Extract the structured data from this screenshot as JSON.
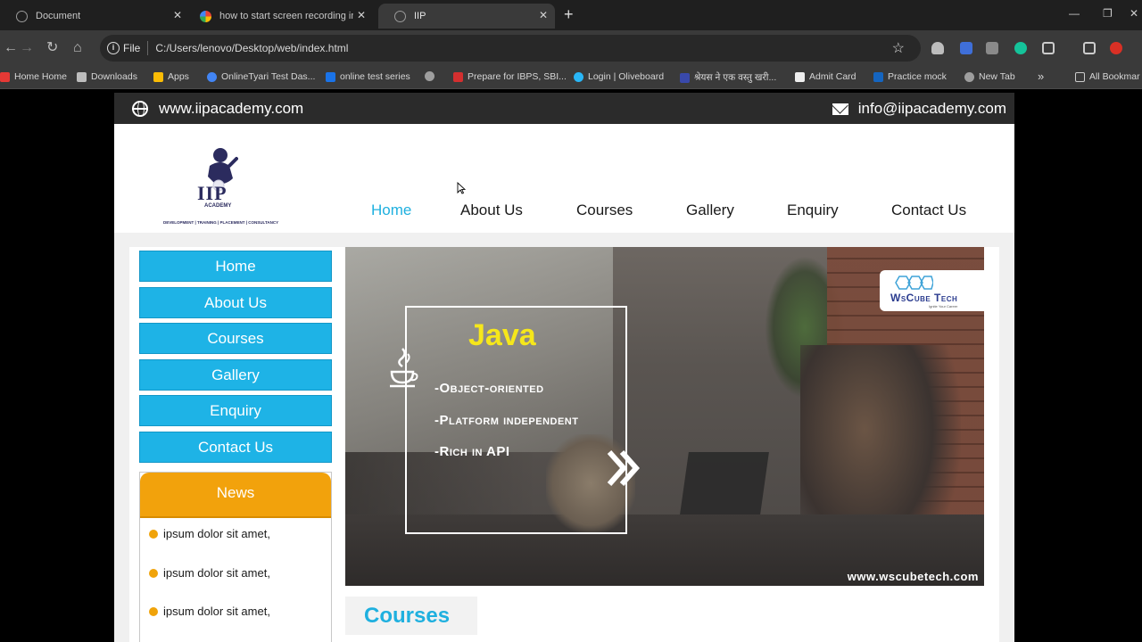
{
  "browser": {
    "tabs": [
      {
        "title": "Document",
        "active": false
      },
      {
        "title": "how to start screen recording in",
        "active": false
      },
      {
        "title": "IIP",
        "active": true
      }
    ],
    "address": {
      "scheme_label": "File",
      "url": "C:/Users/lenovo/Desktop/web/index.html"
    },
    "bookmarks": [
      {
        "label": "Home Home",
        "color": "#e53935"
      },
      {
        "label": "Downloads",
        "color": "#bdbdbd"
      },
      {
        "label": "Apps",
        "color": "#fbbc05"
      },
      {
        "label": "OnlineTyari Test Das...",
        "color": "#4285f4"
      },
      {
        "label": "online test series",
        "color": "#1a73e8"
      },
      {
        "label": "",
        "color": "#9e9e9e"
      },
      {
        "label": "Prepare for IBPS, SBI...",
        "color": "#d32f2f"
      },
      {
        "label": "Login | Oliveboard",
        "color": "#29b6f6"
      },
      {
        "label": "श्रेयस ने एक वस्तु खरी...",
        "color": "#3949ab"
      },
      {
        "label": "Admit Card",
        "color": "#eeeeee"
      },
      {
        "label": "Practice mock",
        "color": "#1565c0"
      },
      {
        "label": "New Tab",
        "color": "#9e9e9e"
      }
    ],
    "all_bookmarks_label": "All Bookmar"
  },
  "site": {
    "top_strip": {
      "website": "www.iipacademy.com",
      "email": "info@iipacademy.com"
    },
    "logo": {
      "name": "IIP",
      "sub": "ACADEMY",
      "tagline": "DEVELOPMENT | TRAINING | PLACEMENT | CONSULTANCY"
    },
    "main_nav": [
      {
        "label": "Home",
        "active": true
      },
      {
        "label": "About Us",
        "active": false
      },
      {
        "label": "Courses",
        "active": false
      },
      {
        "label": "Gallery",
        "active": false
      },
      {
        "label": "Enquiry",
        "active": false
      },
      {
        "label": "Contact Us",
        "active": false
      }
    ],
    "side_nav": [
      "Home",
      "About Us",
      "Courses",
      "Gallery",
      "Enquiry",
      "Contact Us"
    ],
    "news": {
      "title": "News",
      "items": [
        "ipsum dolor sit amet,",
        "ipsum dolor sit amet,",
        "ipsum dolor sit amet,"
      ]
    },
    "banner": {
      "heading": "Java",
      "points": [
        "-Object-oriented",
        "-Platform independent",
        "-Rich in API"
      ],
      "brand": "WsCube Tech",
      "brand_sub": "Ignite Your Career",
      "url": "www.wscubetech.com"
    },
    "section_title": "Courses",
    "colors": {
      "accent": "#1fb0df",
      "side_button": "#1eb3e6",
      "news_header": "#f2a20c",
      "top_strip": "#2b2b2b",
      "java_yellow": "#f6e71b"
    }
  }
}
